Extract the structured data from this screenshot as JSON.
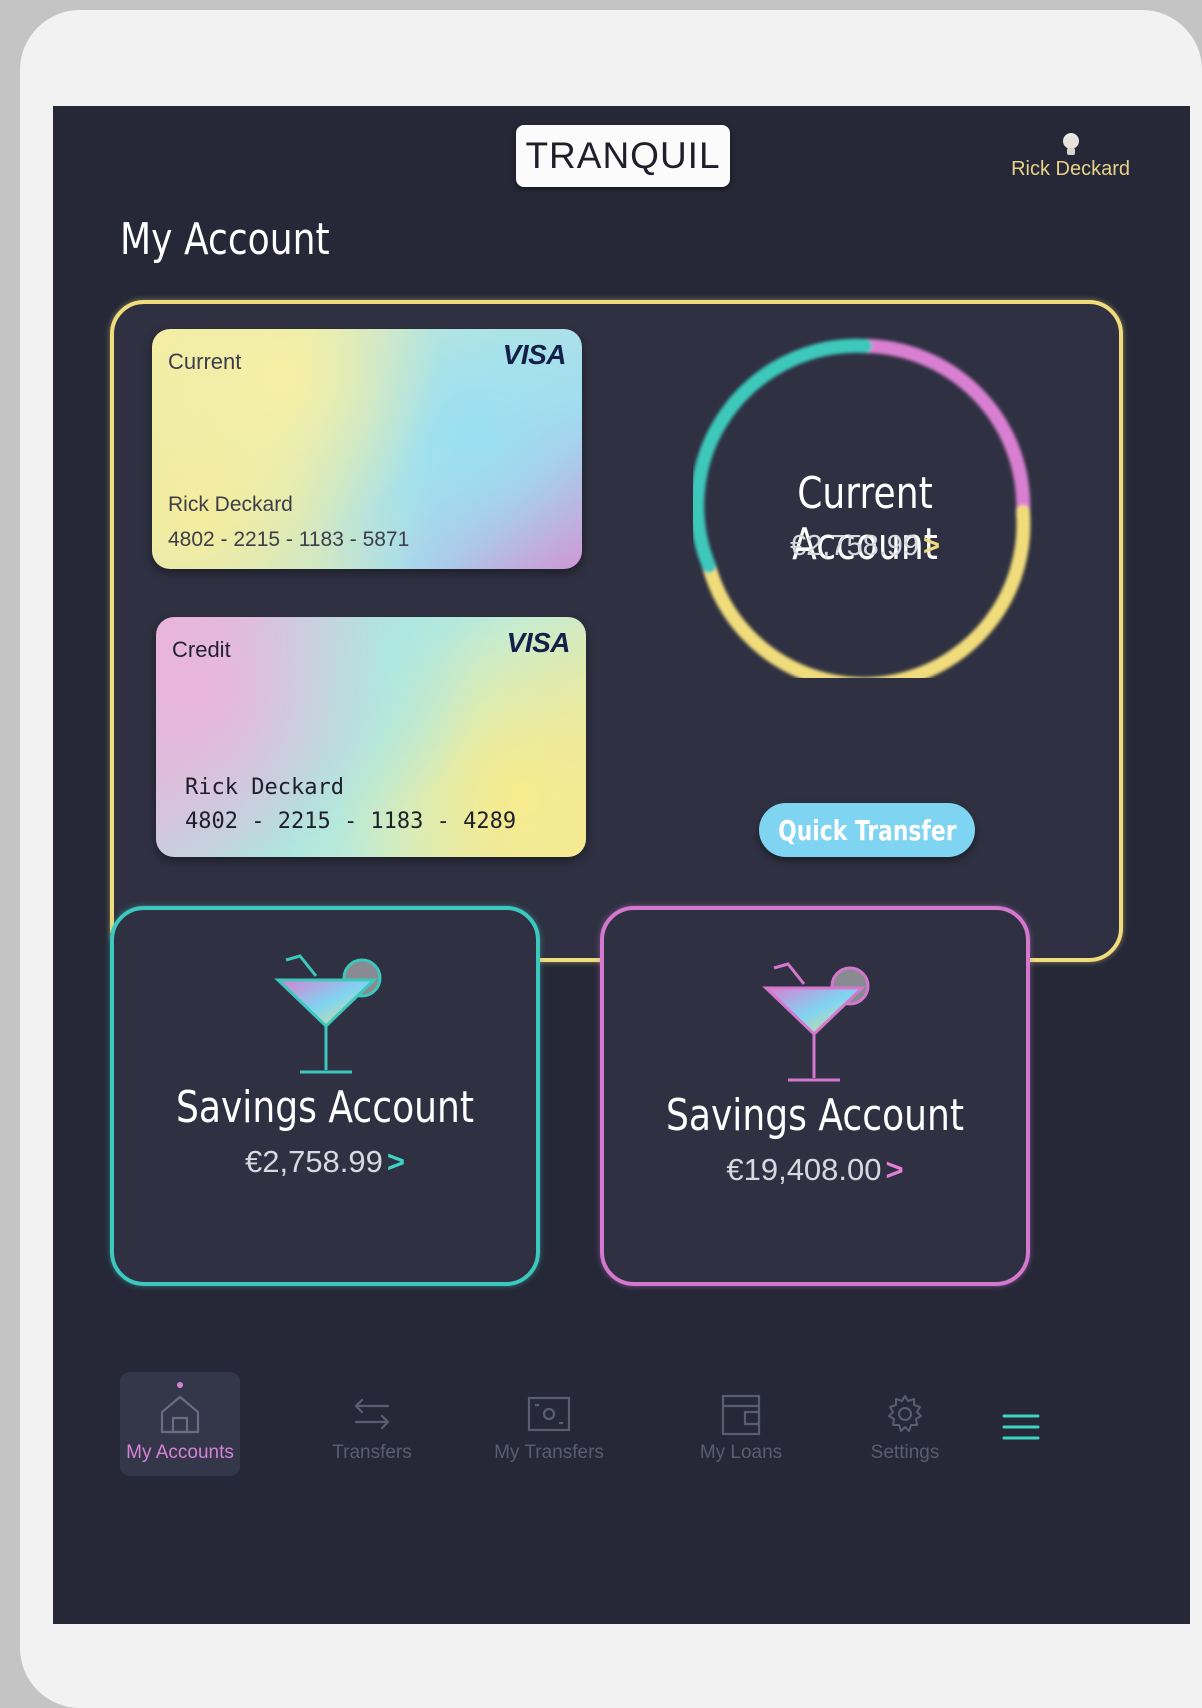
{
  "header": {
    "logo_text": "TRANQUIL",
    "user_name": "Rick Deckard"
  },
  "page_title": "My Account",
  "cards": {
    "current": {
      "type": "Current",
      "brand": "VISA",
      "holder": "Rick Deckard",
      "number": "4802 - 2215 - 1183 - 5871"
    },
    "credit": {
      "type": "Credit",
      "brand": "VISA",
      "holder": "Rick Deckard",
      "number": "4802 - 2215 - 1183 - 4289"
    }
  },
  "current_account": {
    "title": "Current Account",
    "amount": "€2,758.99",
    "chevron": ">"
  },
  "quick_transfer_label": "Quick Transfer",
  "savings": [
    {
      "title": "Savings Account",
      "amount": "€2,758.99",
      "chevron": ">",
      "accent": "#3cc8bc"
    },
    {
      "title": "Savings Account",
      "amount": "€19,408.00",
      "chevron": ">",
      "accent": "#d478cf"
    }
  ],
  "nav": {
    "items": [
      {
        "label": "My Accounts",
        "icon": "home-icon",
        "active": true
      },
      {
        "label": "Transfers",
        "icon": "transfer-arrows-icon",
        "active": false
      },
      {
        "label": "My Transfers",
        "icon": "banknote-icon",
        "active": false
      },
      {
        "label": "My Loans",
        "icon": "wallet-icon",
        "active": false
      },
      {
        "label": "Settings",
        "icon": "gear-icon",
        "active": false
      }
    ],
    "menu_icon": "hamburger-menu-icon"
  },
  "colors": {
    "background": "#262838",
    "panel": "#2f3142",
    "yellow": "#f1dc7c",
    "teal": "#3cc8bc",
    "pink": "#d478cf",
    "button": "#7fd4f2",
    "active_nav": "#d683d6"
  }
}
